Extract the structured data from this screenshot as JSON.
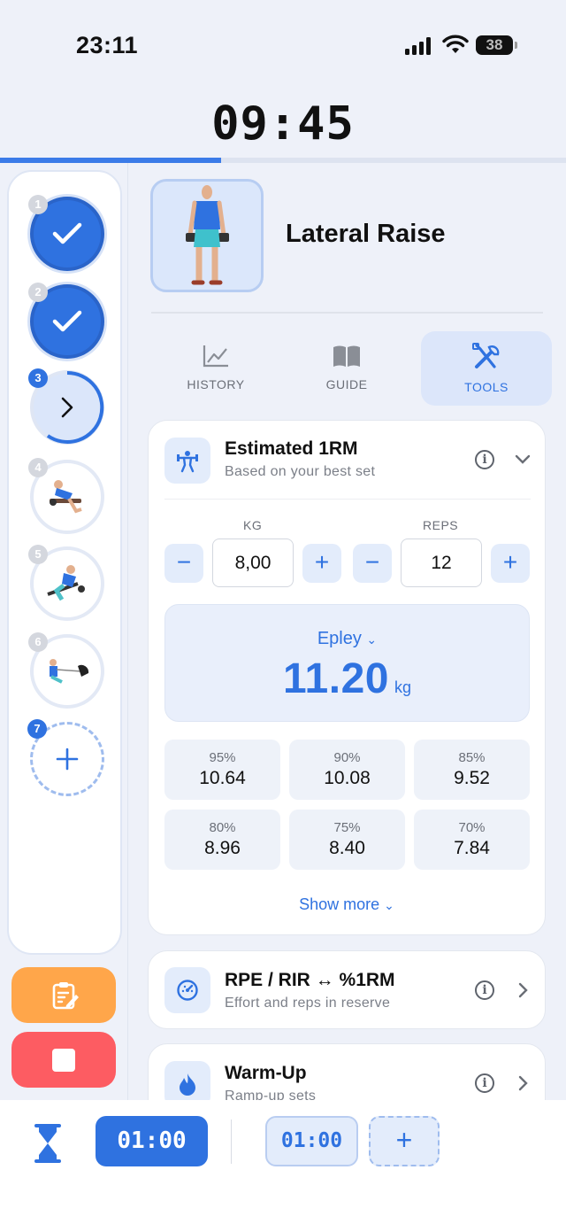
{
  "status": {
    "time": "23:11",
    "battery": "38"
  },
  "timer": "09:45",
  "progress_fraction": 0.39,
  "rail": {
    "items": [
      {
        "num": "1",
        "state": "done"
      },
      {
        "num": "2",
        "state": "done"
      },
      {
        "num": "3",
        "state": "current"
      },
      {
        "num": "4",
        "state": "todo"
      },
      {
        "num": "5",
        "state": "todo"
      },
      {
        "num": "6",
        "state": "todo"
      },
      {
        "num": "7",
        "state": "add"
      }
    ]
  },
  "exercise": {
    "title": "Lateral Raise"
  },
  "tabs": [
    {
      "label": "HISTORY",
      "icon": "chart-icon"
    },
    {
      "label": "GUIDE",
      "icon": "book-icon"
    },
    {
      "label": "TOOLS",
      "icon": "tools-icon",
      "active": true
    }
  ],
  "one_rm": {
    "title": "Estimated 1RM",
    "subtitle": "Based on your best set",
    "kg_label": "KG",
    "reps_label": "REPS",
    "kg_value": "8,00",
    "reps_value": "12",
    "formula": "Epley",
    "result": "11.20",
    "unit": "kg",
    "percentages": [
      {
        "pct": "95%",
        "value": "10.64"
      },
      {
        "pct": "90%",
        "value": "10.08"
      },
      {
        "pct": "85%",
        "value": "9.52"
      },
      {
        "pct": "80%",
        "value": "8.96"
      },
      {
        "pct": "75%",
        "value": "8.40"
      },
      {
        "pct": "70%",
        "value": "7.84"
      }
    ],
    "show_more": "Show more"
  },
  "rpe": {
    "title": "RPE / RIR ↔ %1RM",
    "subtitle": "Effort and reps in reserve"
  },
  "warmup": {
    "title": "Warm-Up",
    "subtitle": "Ramp-up sets"
  },
  "bottom": {
    "rest_active": "01:00",
    "rest_alt": "01:00",
    "add": "+"
  },
  "colors": {
    "accent": "#2f72e0",
    "orange": "#ffa64a",
    "red": "#fd5c62"
  }
}
